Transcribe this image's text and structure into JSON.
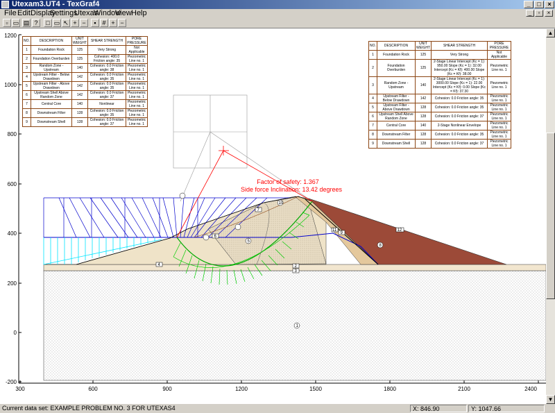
{
  "window": {
    "title": "Utexam3.UT4 - TexGraf4"
  },
  "menu": [
    "File",
    "Edit",
    "Display",
    "Settings",
    "Utexas",
    "Window",
    "View",
    "Help"
  ],
  "toolbar": [
    "new-icon",
    "open-icon",
    "print-icon",
    "help-icon",
    "rect-icon",
    "rect2-icon",
    "pointer-icon",
    "zoom-in-icon",
    "zoom-out-icon",
    "fit-icon",
    "grid-icon",
    "add-icon",
    "remove-icon"
  ],
  "axes": {
    "y_ticks": [
      "1200",
      "1000",
      "800",
      "600",
      "400",
      "200",
      "0",
      "-200"
    ],
    "x_ticks": [
      "300",
      "600",
      "900",
      "1200",
      "1500",
      "1800",
      "2100",
      "2400"
    ]
  },
  "annotation": {
    "factor_of_safety": "Factor of safety: 1.367",
    "side_force": "Side force Inclination: 13.42 degrees"
  },
  "left_table": {
    "headers": [
      "NO.",
      "DESCRIPTION",
      "UNIT WEIGHT",
      "SHEAR STRENGTH",
      "PORE PRESSURE"
    ],
    "rows": [
      [
        "1",
        "Foundation Rock",
        "125",
        "Very Strong",
        "Not Applicable"
      ],
      [
        "2",
        "Foundation Overburden",
        "125",
        "Cohesion: 400.0 Friction angle: 35",
        "Piezometric Line no. 1"
      ],
      [
        "3",
        "Random Zone - Upstream",
        "140",
        "Cohesion: 0.0 Friction angle: 38",
        "Piezometric Line no. 1"
      ],
      [
        "4",
        "Upstream Filter - Below Drawdown",
        "142",
        "Cohesion: 0.0 Friction angle: 35",
        "Piezometric Line no. 1"
      ],
      [
        "5",
        "Upstream Filter - Above Drawdown",
        "142",
        "Cohesion: 0.0 Friction angle: 35",
        "Piezometric Line no. 1"
      ],
      [
        "6",
        "Upstream Shell Above Random Zone",
        "142",
        "Cohesion: 0.0 Friction angle: 37",
        "Piezometric Line no. 1"
      ],
      [
        "7",
        "Central Core",
        "140",
        "Nonlinear",
        "Piezometric Line no. 1"
      ],
      [
        "8",
        "Downstream Filter",
        "128",
        "Cohesion: 0.0 Friction angle: 35",
        "Piezometric Line no. 1"
      ],
      [
        "9",
        "Downstream Shell",
        "128",
        "Cohesion: 0.0 Friction angle: 37",
        "Piezometric Line no. 1"
      ]
    ]
  },
  "right_table": {
    "headers": [
      "NO.",
      "DESCRIPTION",
      "UNIT WEIGHT",
      "SHEAR STRENGTH",
      "PORE PRESSURE"
    ],
    "rows": [
      [
        "1",
        "Foundation Rock",
        "125",
        "Very Strong",
        "Not Applicable"
      ],
      [
        "2",
        "Foundation Overburden",
        "125",
        "2-Stage Linear Intercept (Kc = 1): 950.00 Slope (Kc = 1): 32.00 Intercept (Kc = Kf): 400.00 Slope (Kc = Kf): 38.00",
        "Piezometric Line no. 1"
      ],
      [
        "3",
        "Random Zone - Upstream",
        "140",
        "2-Stage Linear Intercept (Kc = 1): 3000.00 Slope (Kc = 1): 22.00 Intercept (Kc = Kf): 0.00 Slope (Kc = Kf): 37.30",
        "Piezometric Line no. 1"
      ],
      [
        "4",
        "Upstream Filter - Below Drawdown",
        "142",
        "Cohesion: 0.0 Friction angle: 35",
        "Piezometric Line no. 1"
      ],
      [
        "5",
        "Upstream Filter - Above Drawdown",
        "128",
        "Cohesion: 0.0 Friction angle: 35",
        "Piezometric Line no. 1"
      ],
      [
        "6",
        "Upstream Shell Above Random Zone",
        "128",
        "Cohesion: 0.0 Friction angle: 37",
        "Piezometric Line no. 1"
      ],
      [
        "7",
        "Central Core",
        "140",
        "2-Stage Nonlinear Envelope",
        "Piezometric Line no. 1"
      ],
      [
        "8",
        "Downstream Filter",
        "128",
        "Cohesion: 0.0 Friction angle: 35",
        "Piezometric Line no. 1"
      ],
      [
        "9",
        "Downstream Shell",
        "128",
        "Cohesion: 0.0 Friction angle: 37",
        "Piezometric Line no. 1"
      ]
    ]
  },
  "region_labels": [
    "1",
    "2",
    "3",
    "4",
    "5",
    "6",
    "7",
    "8",
    "9",
    "10",
    "11",
    "12"
  ],
  "status": {
    "message": "Current data set: EXAMPLE PROBLEM NO. 3 FOR UTEXAS4",
    "x_value": "X: 846.90",
    "y_value": "Y: 1047.66"
  },
  "colors": {
    "titlebar": "#0a246a",
    "downstream_shell": "#9c4a38",
    "core": "#e8dcc4",
    "filter": "#e4c89c",
    "foundation": "#f2e6cf",
    "slip_forces": "#00cc00",
    "water_forces": "#00e5ff",
    "interslice": "#0000cc",
    "annotation": "#ff0000"
  }
}
